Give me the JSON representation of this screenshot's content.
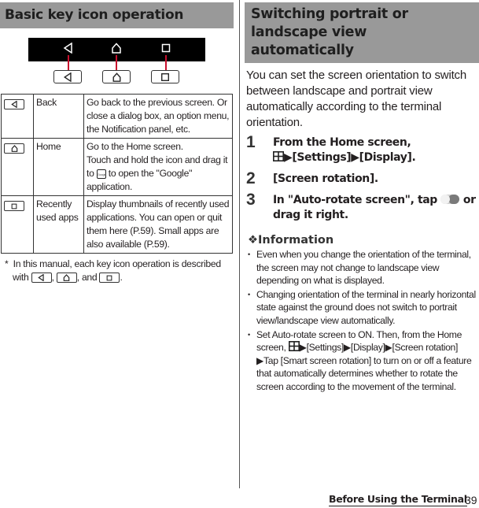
{
  "left": {
    "title": "Basic key icon operation",
    "navbar_icons": [
      "back-icon",
      "home-icon",
      "recent-apps-icon"
    ],
    "leader_color": "#c8102e",
    "keys": [
      {
        "icon": "back-icon",
        "name": "Back",
        "description": "Go back to the previous screen. Or close a dialog box, an option menu, the Notification panel, etc."
      },
      {
        "icon": "home-icon",
        "name": "Home",
        "description_line1": "Go to the Home screen.",
        "description_line2a": "Touch and hold the icon and drag it to",
        "description_line2b": "to open the \"Google\" application.",
        "google_icon_label": "Google"
      },
      {
        "icon": "recent-apps-icon",
        "name": "Recently used apps",
        "description": "Display thumbnails of recently used applications. You can open or quit them here (P.59). Small apps are also available (P.59)."
      }
    ],
    "note_prefix": "*",
    "note_text_before": "In this manual, each key icon operation is described with",
    "note_sep1": ",",
    "note_sep2": ", and",
    "note_end": "."
  },
  "right": {
    "title": "Switching portrait or landscape view automatically",
    "intro": "You can set the screen orientation to switch between landscape and portrait view automatically according to the terminal orientation.",
    "steps": [
      {
        "num": "1",
        "text_a": "From the Home screen,",
        "text_b": "▶[Settings]▶[Display]."
      },
      {
        "num": "2",
        "text": "[Screen rotation]."
      },
      {
        "num": "3",
        "text_a": "In \"Auto-rotate screen\", tap",
        "text_b": "or drag it right."
      }
    ],
    "info_heading": "❖Information",
    "info_items": [
      "Even when you change the orientation of the terminal, the screen may not change to landscape view depending on what is displayed.",
      "Changing orientation of the terminal in nearly horizontal state against the ground does not switch to portrait view/landscape view automatically."
    ],
    "info_item3_a": "Set Auto-rotate screen to ON. Then, from the Home screen,",
    "info_item3_b": "▶[Settings]▶[Display]▶[Screen rotation] ▶Tap [Smart screen rotation] to turn on or off a feature that automatically determines whether to rotate the screen according to the movement of the terminal."
  },
  "footer": {
    "section": "Before Using the Terminal",
    "page": "39"
  }
}
